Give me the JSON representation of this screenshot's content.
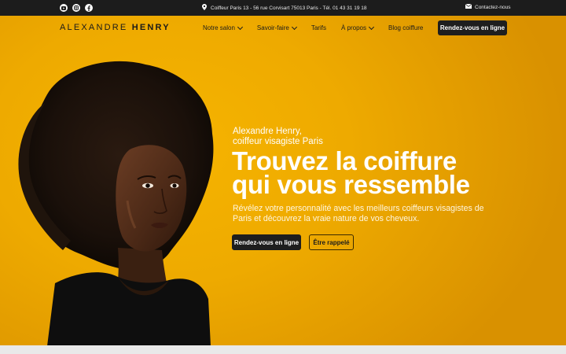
{
  "topbar": {
    "social_icons": [
      "youtube-icon",
      "instagram-icon",
      "facebook-icon"
    ],
    "address": "Coiffeur Paris 13 - 56 rue Corvisart 75013 Paris - Tél. 01 43 31 19 18",
    "contact_label": "Contactez-nous"
  },
  "header": {
    "logo_first": "ALEXANDRE",
    "logo_last": "HENRY",
    "nav": [
      {
        "label": "Notre salon",
        "has_dropdown": true
      },
      {
        "label": "Savoir-faire",
        "has_dropdown": true
      },
      {
        "label": "Tarifs",
        "has_dropdown": false
      },
      {
        "label": "À propos",
        "has_dropdown": true
      },
      {
        "label": "Blog coiffure",
        "has_dropdown": false
      }
    ],
    "cta_label": "Rendez-vous en ligne"
  },
  "hero": {
    "kicker_line1": "Alexandre Henry,",
    "kicker_line2": "coiffeur visagiste Paris",
    "headline_line1": "Trouvez la coiffure",
    "headline_line2": "qui vous ressemble",
    "description": "Révélez votre personnalité avec les meilleurs coiffeurs visagistes de Paris et découvrez la vraie nature de vos cheveux.",
    "primary_button": "Rendez-vous en ligne",
    "secondary_button": "Être rappelé"
  },
  "colors": {
    "accent": "#f0ac00",
    "dark": "#1e1e1e",
    "topbar": "#1c1c1c"
  }
}
